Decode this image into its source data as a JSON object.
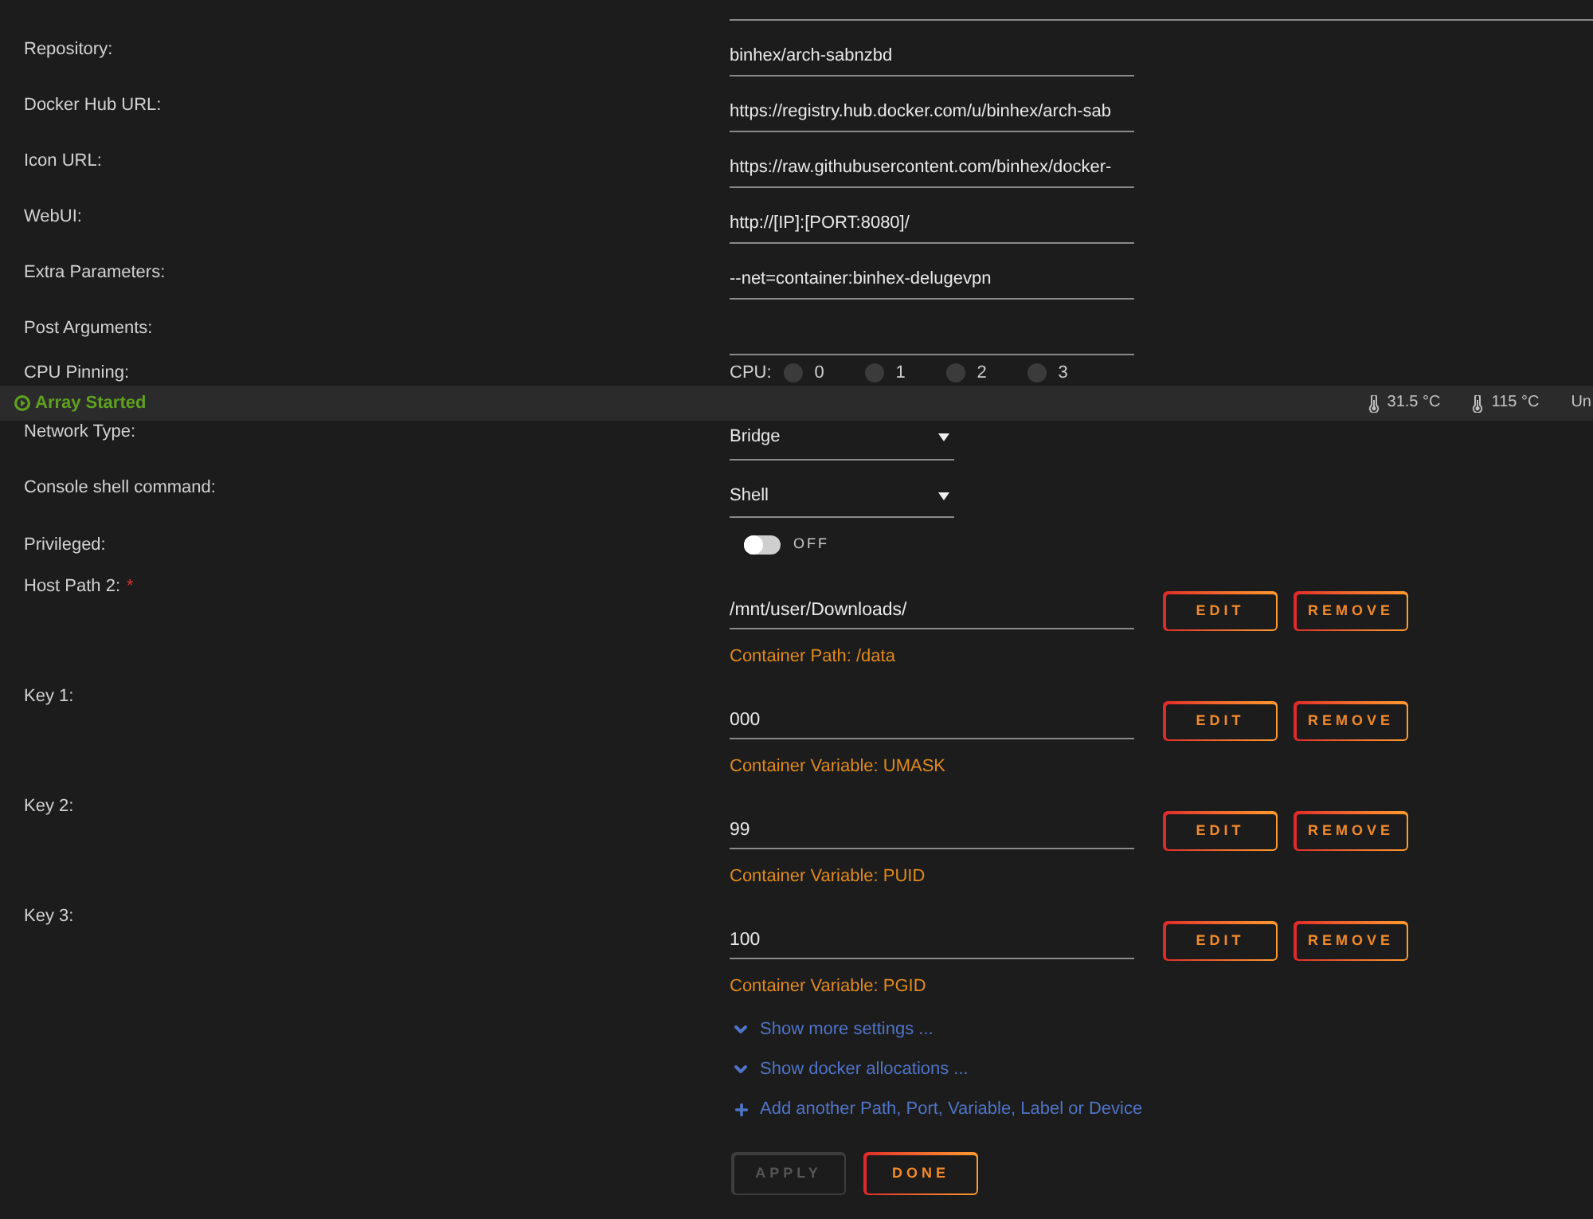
{
  "fields": [
    {
      "label": "Repository:",
      "value": "binhex/arch-sabnzbd"
    },
    {
      "label": "Docker Hub URL:",
      "value": "https://registry.hub.docker.com/u/binhex/arch-sab"
    },
    {
      "label": "Icon URL:",
      "value": "https://raw.githubusercontent.com/binhex/docker-"
    },
    {
      "label": "WebUI:",
      "value": "http://[IP]:[PORT:8080]/"
    },
    {
      "label": "Extra Parameters:",
      "value": "--net=container:binhex-delugevpn"
    },
    {
      "label": "Post Arguments:"
    }
  ],
  "cpu_pinning": {
    "label": "CPU Pinning:",
    "cpu_label": "CPU:",
    "cores": [
      {
        "label": "0",
        "checked": false
      },
      {
        "label": "1",
        "checked": false
      },
      {
        "label": "2",
        "checked": false
      },
      {
        "label": "3",
        "checked": false
      }
    ]
  },
  "status_bar": {
    "status": "Array Started",
    "readings": [
      "31.5 °C",
      "115 °C"
    ],
    "trailing": "Un"
  },
  "settings": [
    {
      "kind": "select",
      "label": "Network Type:",
      "value": "Bridge"
    },
    {
      "kind": "select",
      "label": "Console shell command:",
      "value": "Shell"
    },
    {
      "kind": "toggle",
      "label": "Privileged:",
      "on": false,
      "state_text": "OFF"
    }
  ],
  "mappings": [
    {
      "label": "Host Path 2:",
      "required_mark": "*",
      "value": "/mnt/user/Downloads/",
      "note": "Container Path: /data",
      "buttons": [
        "EDIT",
        "REMOVE"
      ]
    },
    {
      "label": "Key 1:",
      "value": "000",
      "note": "Container Variable: UMASK",
      "buttons": [
        "EDIT",
        "REMOVE"
      ]
    },
    {
      "label": "Key 2:",
      "value": "99",
      "note": "Container Variable: PUID",
      "buttons": [
        "EDIT",
        "REMOVE"
      ]
    },
    {
      "label": "Key 3:",
      "value": "100",
      "note": "Container Variable: PGID",
      "buttons": [
        "EDIT",
        "REMOVE"
      ]
    }
  ],
  "links": [
    {
      "kind": "expand",
      "text": "Show more settings ..."
    },
    {
      "kind": "expand",
      "text": "Show docker allocations ..."
    },
    {
      "kind": "add",
      "text": "Add another Path, Port, Variable, Label or Device"
    }
  ],
  "actions": [
    {
      "label": "APPLY",
      "disabled": true
    },
    {
      "label": "DONE",
      "disabled": false
    }
  ]
}
